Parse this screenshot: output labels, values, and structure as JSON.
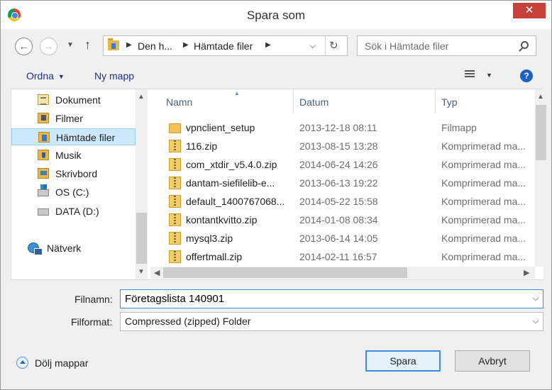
{
  "window": {
    "title": "Spara som",
    "close_label": "✕"
  },
  "address_bar": {
    "crumbs": [
      "Den h...",
      "Hämtade filer"
    ],
    "search_placeholder": "Sök i Hämtade filer"
  },
  "toolbar": {
    "organize": "Ordna",
    "new_folder": "Ny mapp",
    "help": "?"
  },
  "nav_pane": {
    "items": [
      {
        "label": "Dokument",
        "icon": "documents-icon"
      },
      {
        "label": "Filmer",
        "icon": "videos-icon"
      },
      {
        "label": "Hämtade filer",
        "icon": "downloads-icon",
        "selected": true
      },
      {
        "label": "Musik",
        "icon": "music-icon"
      },
      {
        "label": "Skrivbord",
        "icon": "desktop-icon"
      },
      {
        "label": "OS (C:)",
        "icon": "windows-drive-icon"
      },
      {
        "label": "DATA (D:)",
        "icon": "drive-icon"
      },
      {
        "label": "Nätverk",
        "icon": "network-icon"
      }
    ]
  },
  "file_list": {
    "columns": [
      "Namn",
      "Datum",
      "Typ"
    ],
    "rows": [
      {
        "name": "vpnclient_setup",
        "date": "2013-12-18 08:11",
        "type": "Filmapp",
        "icon": "folder-icon"
      },
      {
        "name": "116.zip",
        "date": "2013-08-15 13:28",
        "type": "Komprimerad ma...",
        "icon": "zip-folder-icon"
      },
      {
        "name": "com_xtdir_v5.4.0.zip",
        "date": "2014-06-24 14:26",
        "type": "Komprimerad ma...",
        "icon": "zip-folder-icon"
      },
      {
        "name": "dantam-siefilelib-e...",
        "date": "2013-06-13 19:22",
        "type": "Komprimerad ma...",
        "icon": "zip-folder-icon"
      },
      {
        "name": "default_1400767068...",
        "date": "2014-05-22 15:58",
        "type": "Komprimerad ma...",
        "icon": "zip-folder-icon"
      },
      {
        "name": "kontantkvitto.zip",
        "date": "2014-01-08 08:34",
        "type": "Komprimerad ma...",
        "icon": "zip-folder-icon"
      },
      {
        "name": "mysql3.zip",
        "date": "2013-06-14 14:05",
        "type": "Komprimerad ma...",
        "icon": "zip-folder-icon"
      },
      {
        "name": "offertmall.zip",
        "date": "2014-02-11 16:57",
        "type": "Komprimerad ma...",
        "icon": "zip-folder-icon"
      }
    ]
  },
  "form": {
    "filename_label": "Filnamn:",
    "filename_value": "Företagslista 140901",
    "format_label": "Filformat:",
    "format_value": "Compressed (zipped) Folder"
  },
  "footer": {
    "hide_folders": "Dölj mappar",
    "save": "Spara",
    "cancel": "Avbryt"
  }
}
